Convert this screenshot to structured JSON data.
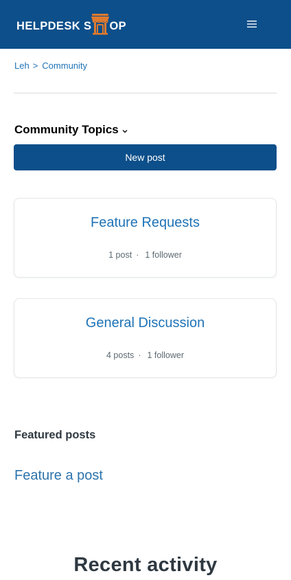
{
  "header": {
    "logo_text_left": "HELPDESK S",
    "logo_text_right": "OP",
    "logo_icon": "shop-awning-icon",
    "menu_icon": "hamburger-menu-icon",
    "background_color": "#0c4f8a",
    "accent_color": "#e07a2e"
  },
  "breadcrumb": {
    "items": [
      "Leh",
      "Community"
    ],
    "separator": ">"
  },
  "topics": {
    "title": "Community Topics",
    "dropdown_icon": "chevron-down-icon"
  },
  "new_post_label": "New post",
  "cards": [
    {
      "title": "Feature Requests",
      "posts": "1 post",
      "followers": "1 follower"
    },
    {
      "title": "General Discussion",
      "posts": "4 posts",
      "followers": "1 follower"
    }
  ],
  "meta_separator": "·",
  "featured": {
    "heading": "Featured posts",
    "link_label": "Feature a post"
  },
  "recent_activity_heading": "Recent activity",
  "colors": {
    "link": "#1f73b7",
    "text": "#2f3941",
    "border": "#e3e6e8"
  }
}
